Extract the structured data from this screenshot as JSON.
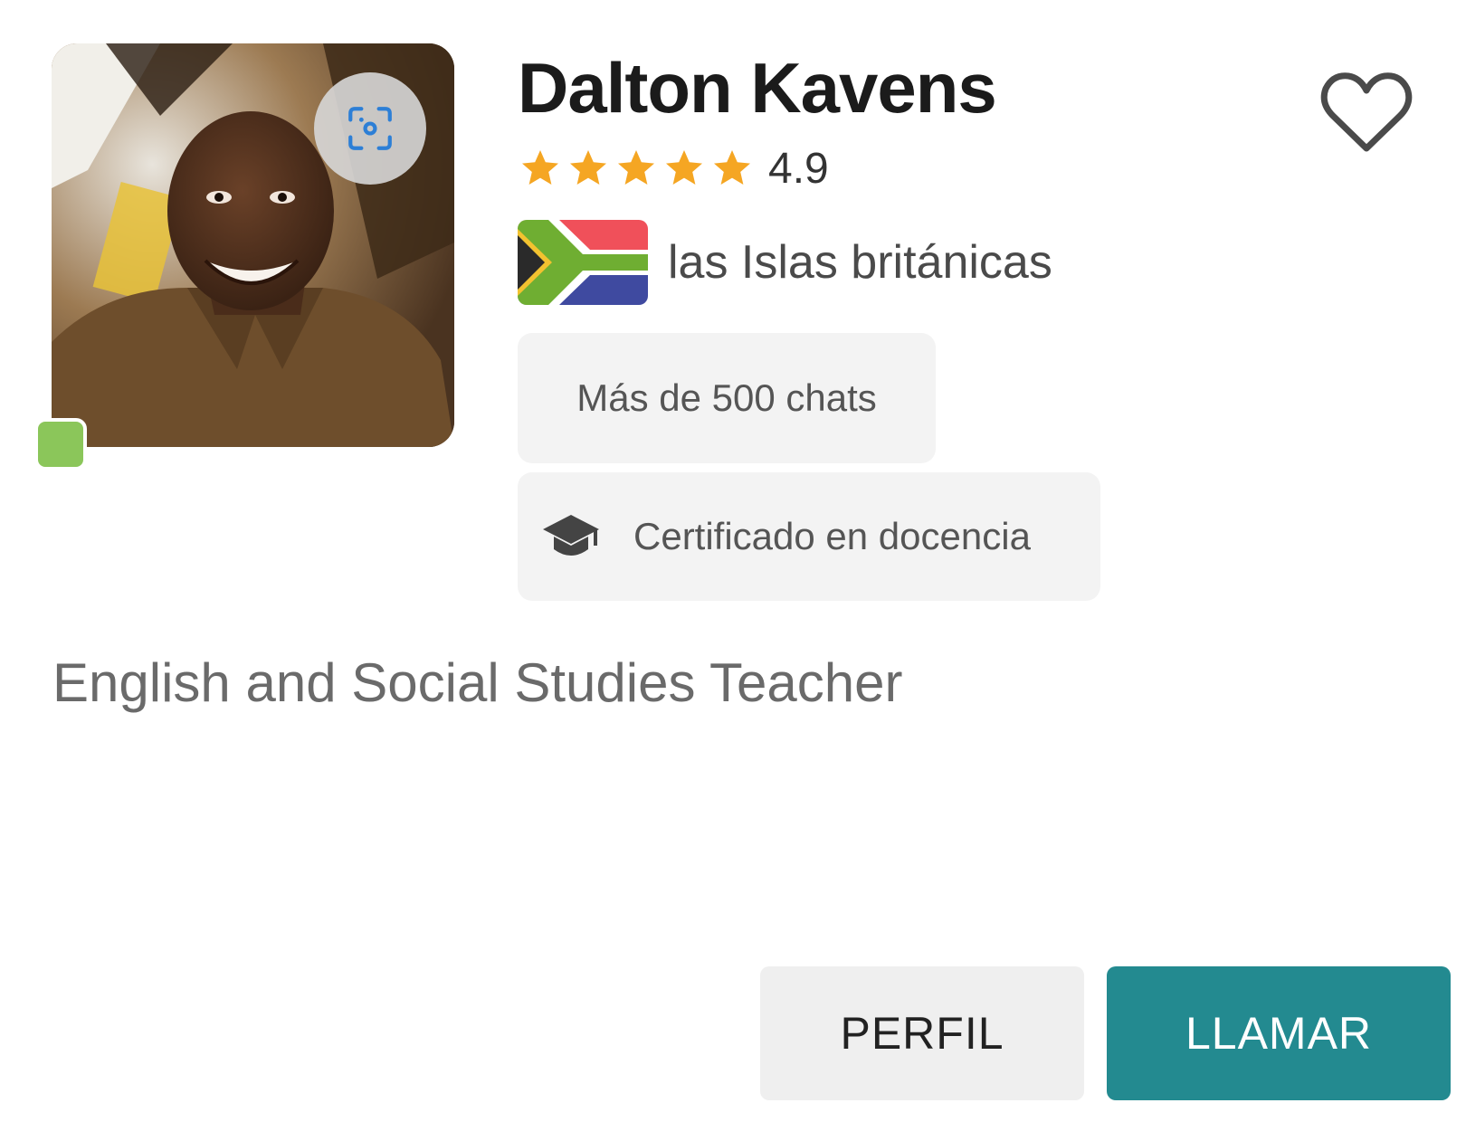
{
  "tutor": {
    "name": "Dalton Kavens",
    "rating": "4.9",
    "rating_stars": 5,
    "country": "las Islas británicas",
    "chats_badge": "Más de 500 chats",
    "certified_badge": "Certificado en docencia",
    "bio": "English and Social Studies Teacher",
    "online": true
  },
  "icons": {
    "photo": "tutor-photo",
    "scan": "scan-icon",
    "favorite": "heart-icon",
    "star": "star-icon",
    "flag": "flag-icon",
    "certificate": "graduation-cap-icon"
  },
  "actions": {
    "profile_label": "PERFIL",
    "call_label": "LLAMAR"
  },
  "colors": {
    "accent": "#238a90",
    "star": "#f5a623",
    "online": "#8bc65a",
    "chip_bg": "#f3f3f3"
  }
}
